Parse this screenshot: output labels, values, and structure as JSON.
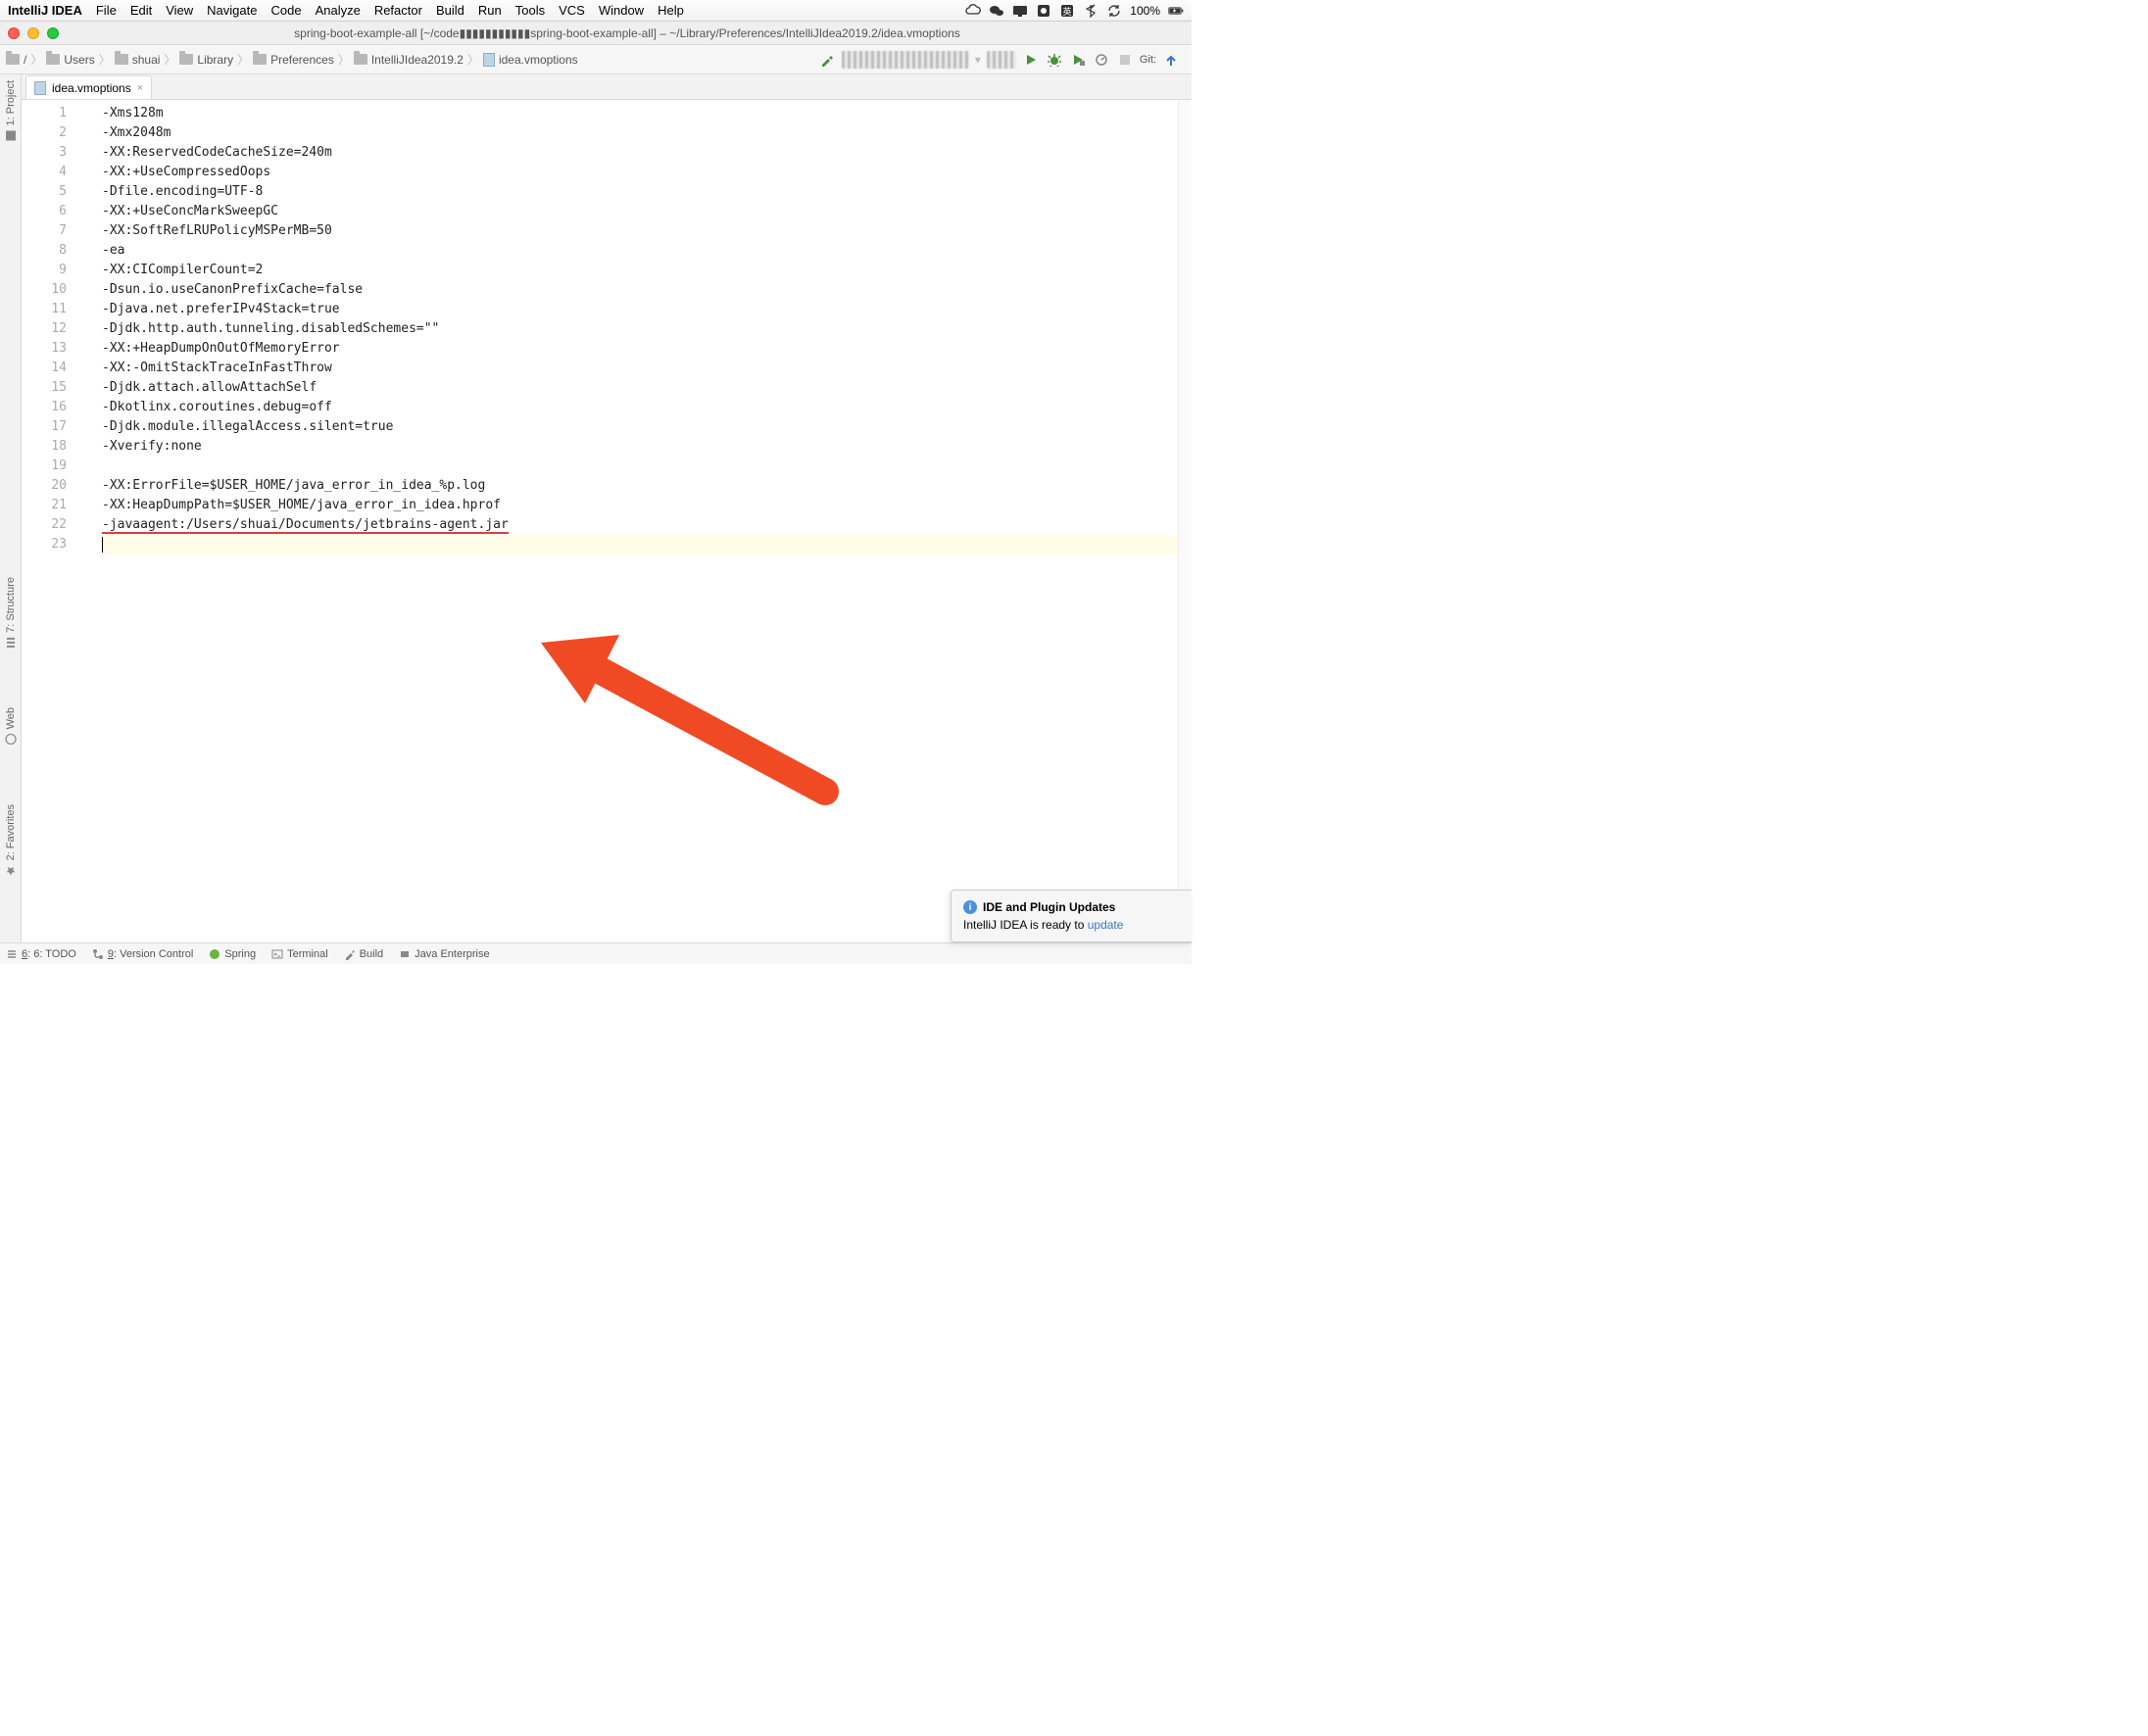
{
  "menubar": {
    "app": "IntelliJ IDEA",
    "items": [
      "File",
      "Edit",
      "View",
      "Navigate",
      "Code",
      "Analyze",
      "Refactor",
      "Build",
      "Run",
      "Tools",
      "VCS",
      "Window",
      "Help"
    ],
    "battery": "100%"
  },
  "titlebar": {
    "title": "spring-boot-example-all [~/code▮▮▮▮▮▮▮▮▮▮▮spring-boot-example-all] – ~/Library/Preferences/IntelliJIdea2019.2/idea.vmoptions"
  },
  "breadcrumbs": [
    "/",
    "Users",
    "shuai",
    "Library",
    "Preferences",
    "IntelliJIdea2019.2",
    "idea.vmoptions"
  ],
  "toolbar": {
    "git": "Git:"
  },
  "tab": {
    "name": "idea.vmoptions"
  },
  "code": {
    "lines": [
      "-Xms128m",
      "-Xmx2048m",
      "-XX:ReservedCodeCacheSize=240m",
      "-XX:+UseCompressedOops",
      "-Dfile.encoding=UTF-8",
      "-XX:+UseConcMarkSweepGC",
      "-XX:SoftRefLRUPolicyMSPerMB=50",
      "-ea",
      "-XX:CICompilerCount=2",
      "-Dsun.io.useCanonPrefixCache=false",
      "-Djava.net.preferIPv4Stack=true",
      "-Djdk.http.auth.tunneling.disabledSchemes=\"\"",
      "-XX:+HeapDumpOnOutOfMemoryError",
      "-XX:-OmitStackTraceInFastThrow",
      "-Djdk.attach.allowAttachSelf",
      "-Dkotlinx.coroutines.debug=off",
      "-Djdk.module.illegalAccess.silent=true",
      "-Xverify:none",
      "",
      "-XX:ErrorFile=$USER_HOME/java_error_in_idea_%p.log",
      "-XX:HeapDumpPath=$USER_HOME/java_error_in_idea.hprof",
      "-javaagent:/Users/shuai/Documents/jetbrains-agent.jar",
      ""
    ],
    "underline_line": 22,
    "highlighted_line": 23
  },
  "side_tools": {
    "project": "1: Project",
    "structure": "7: Structure",
    "web": "Web",
    "favorites": "2: Favorites"
  },
  "bottom_tools": {
    "todo": "6: TODO",
    "vcs": "9: Version Control",
    "spring": "Spring",
    "terminal": "Terminal",
    "build": "Build",
    "jee": "Java Enterprise"
  },
  "notification": {
    "title": "IDE and Plugin Updates",
    "body_prefix": "IntelliJ IDEA is ready to ",
    "link": "update"
  }
}
